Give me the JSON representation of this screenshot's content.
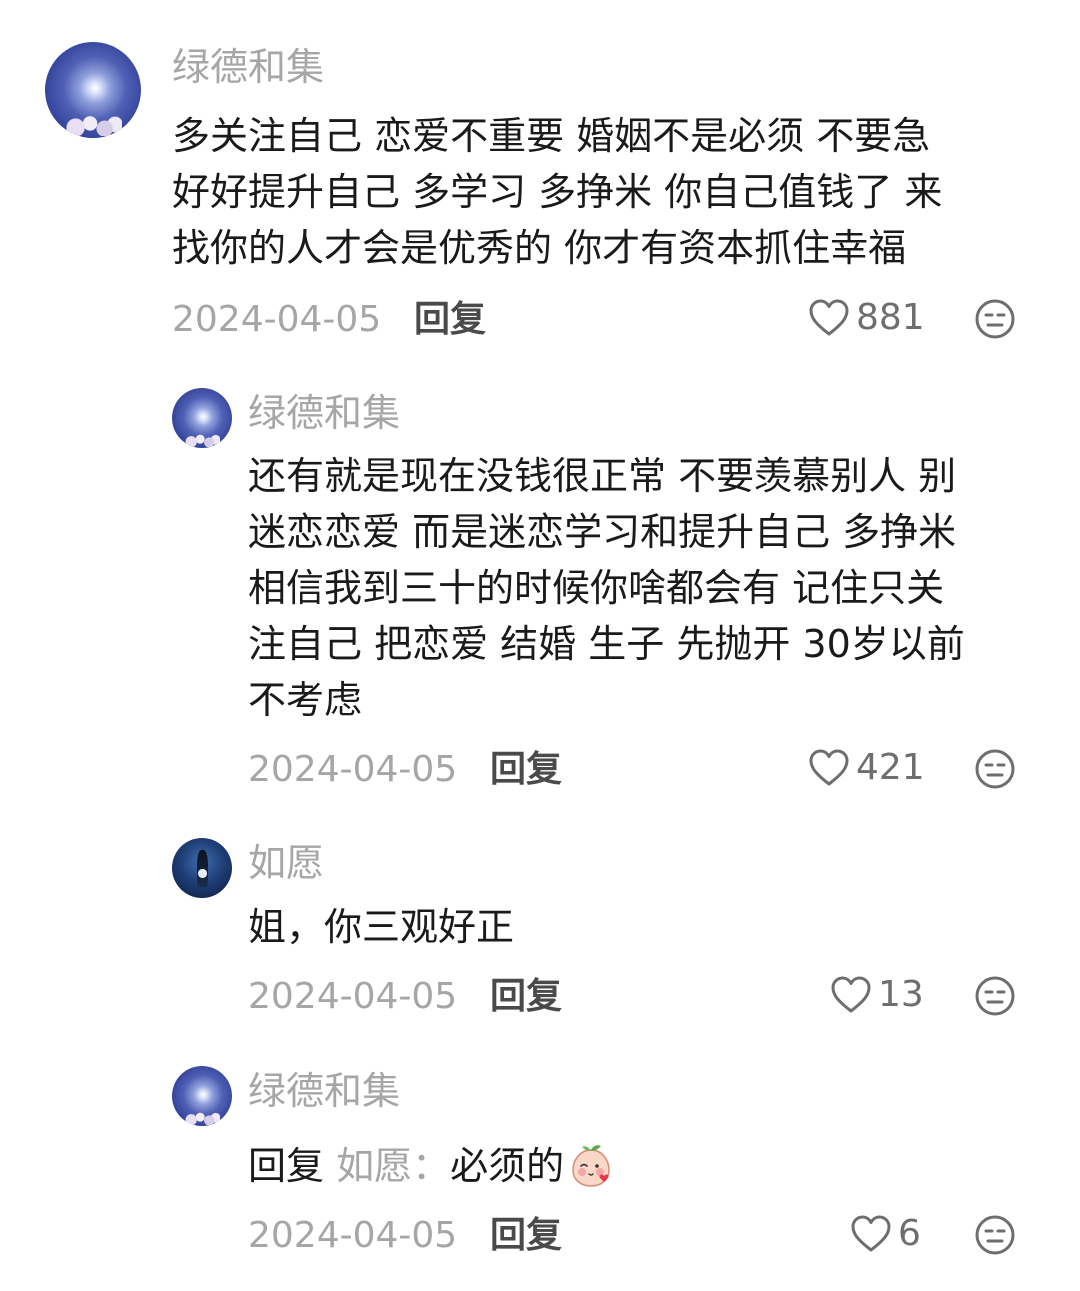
{
  "comments": [
    {
      "username": "绿德和集",
      "text": "多关注自己 恋爱不重要 婚姻不是必须 不要急\n好好提升自己 多学习 多挣米 你自己值钱了 来\n找你的人才会是优秀的 你才有资本抓住幸福",
      "date": "2024-04-05",
      "reply_label": "回复",
      "likes": "881",
      "avatar_icon": "moon-avatar"
    },
    {
      "username": "绿德和集",
      "text": "还有就是现在没钱很正常 不要羡慕别人 别\n迷恋恋爱 而是迷恋学习和提升自己 多挣米\n相信我到三十的时候你啥都会有 记住只关\n注自己 把恋爱 结婚 生子 先抛开 30岁以前\n不考虑",
      "date": "2024-04-05",
      "reply_label": "回复",
      "likes": "421",
      "avatar_icon": "moon-avatar"
    },
    {
      "username": "如愿",
      "text": "姐，你三观好正",
      "date": "2024-04-05",
      "reply_label": "回复",
      "likes": "13",
      "avatar_icon": "night-figure-avatar"
    },
    {
      "username": "绿德和集",
      "reply_prefix": "回复",
      "reply_target": "如愿：",
      "text": "必须的",
      "sticker_icon": "peach-blush-sticker",
      "date": "2024-04-05",
      "reply_label": "回复",
      "likes": "6",
      "avatar_icon": "moon-avatar"
    }
  ],
  "icons": {
    "like": "heart-outline-icon",
    "dislike": "neutral-face-icon"
  },
  "colors": {
    "username": "#a6a6a6",
    "body_text": "#1a1a1a",
    "meta_text": "#a6a6a6",
    "reply_action": "#4a4a4a"
  }
}
